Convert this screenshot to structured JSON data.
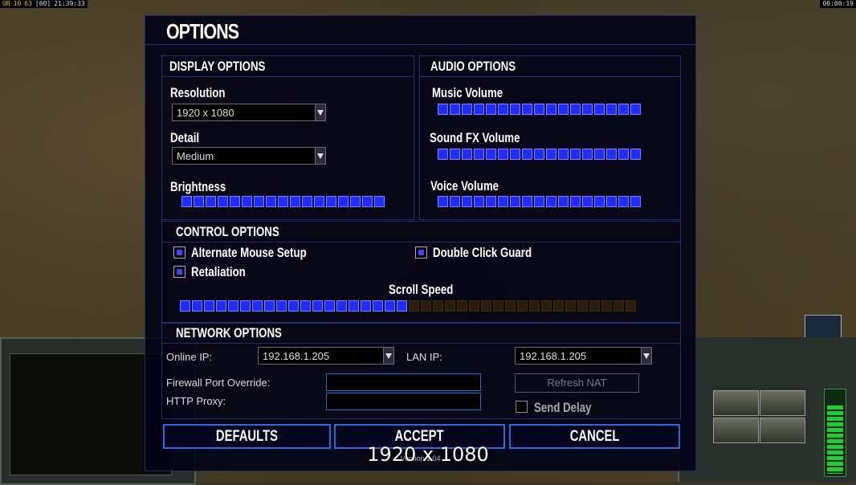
{
  "hud": {
    "left_a": "UR",
    "left_b": "10",
    "left_c": "63",
    "left_d": "[60]",
    "left_time": "21:39:33",
    "right_time": "00:00:19"
  },
  "title": "OPTIONS",
  "display": {
    "header": "DISPLAY OPTIONS",
    "resolution_label": "Resolution",
    "resolution_value": "1920 x 1080",
    "detail_label": "Detail",
    "detail_value": "Medium",
    "brightness_label": "Brightness",
    "brightness_level": 1.0
  },
  "audio": {
    "header": "AUDIO OPTIONS",
    "music_label": "Music Volume",
    "music_level": 1.0,
    "sfx_label": "Sound FX Volume",
    "sfx_level": 1.0,
    "voice_label": "Voice Volume",
    "voice_level": 1.0
  },
  "control": {
    "header": "CONTROL OPTIONS",
    "alt_mouse_label": "Alternate Mouse Setup",
    "alt_mouse_checked": true,
    "double_click_label": "Double Click Guard",
    "double_click_checked": true,
    "retaliation_label": "Retaliation",
    "retaliation_checked": true,
    "scroll_label": "Scroll Speed",
    "scroll_level": 0.5
  },
  "network": {
    "header": "NETWORK OPTIONS",
    "online_ip_label": "Online IP:",
    "online_ip_value": "192.168.1.205",
    "lan_ip_label": "LAN IP:",
    "lan_ip_value": "192.168.1.205",
    "firewall_label": "Firewall Port Override:",
    "firewall_value": "",
    "proxy_label": "HTTP Proxy:",
    "proxy_value": "",
    "refresh_nat_label": "Refresh NAT",
    "send_delay_label": "Send Delay",
    "send_delay_checked": false
  },
  "buttons": {
    "defaults": "DEFAULTS",
    "accept": "ACCEPT",
    "cancel": "CANCEL"
  },
  "version": "Version 1.04",
  "overlay_resolution": "1920 x 1080",
  "colors": {
    "slider_on": "#1f2dff",
    "slider_off": "#2a1e0a",
    "panel_border": "#24306a",
    "button_border": "#2a6adf"
  }
}
